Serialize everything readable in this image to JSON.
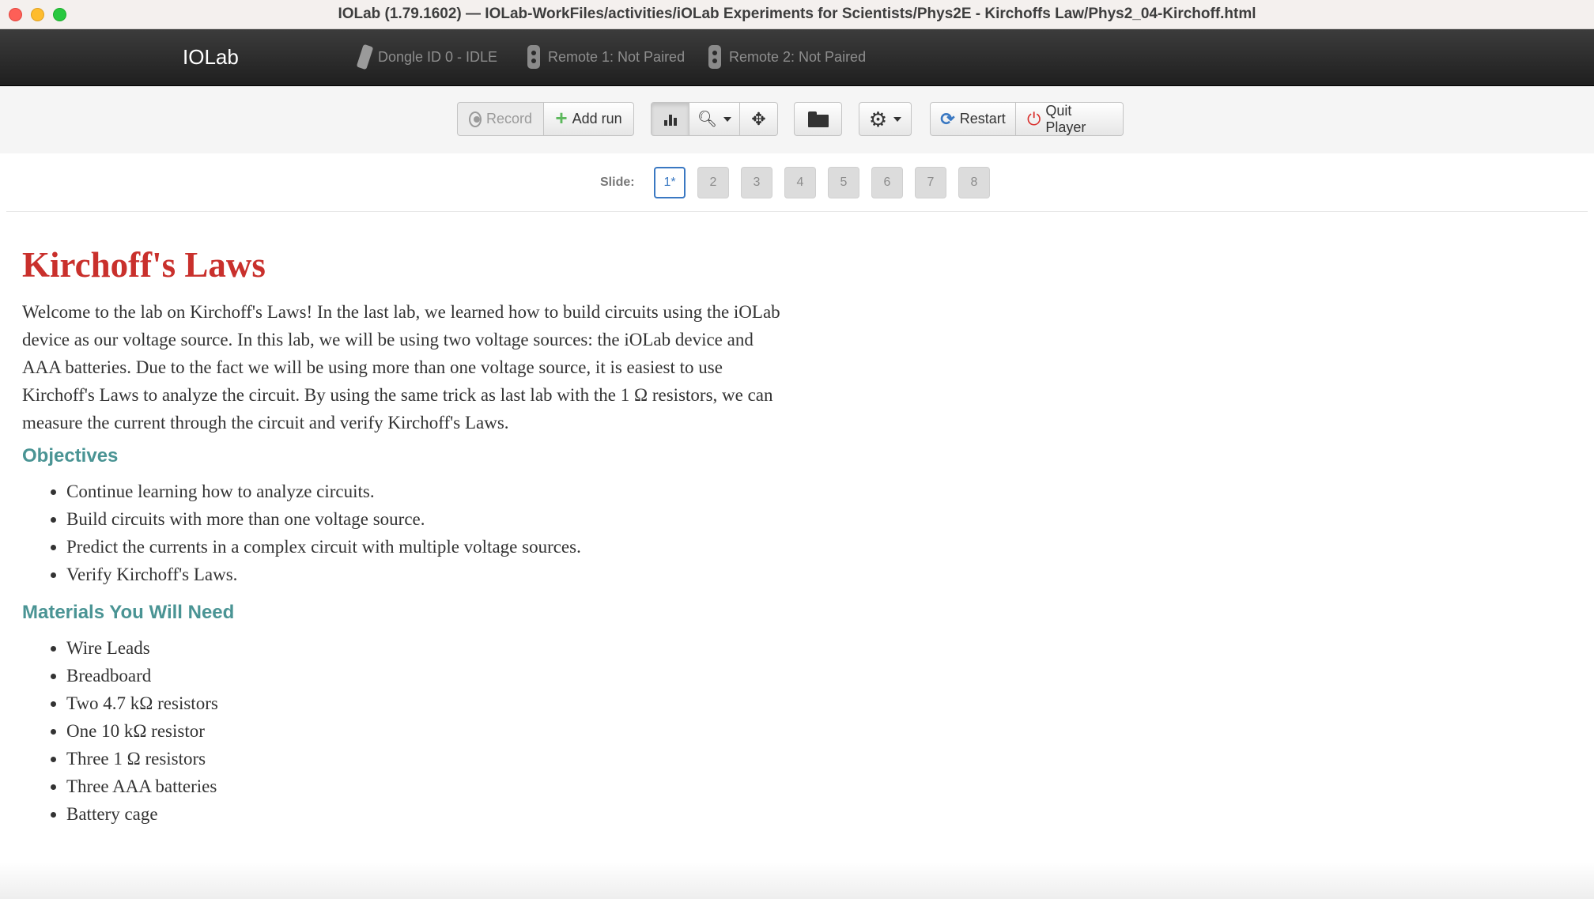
{
  "window": {
    "title": "IOLab (1.79.1602) — IOLab-WorkFiles/activities/iOLab Experiments for Scientists/Phys2E - Kirchoffs Law/Phys2_04-Kirchoff.html"
  },
  "navbar": {
    "brand": "IOLab",
    "dongle_status": "Dongle ID 0 - IDLE",
    "remote1_status": "Remote 1: Not Paired",
    "remote2_status": "Remote 2: Not Paired",
    "icons": [
      "dongle-icon",
      "remote-icon",
      "remote-icon"
    ]
  },
  "toolbar": {
    "record_label": "Record",
    "add_run_label": "Add run",
    "restart_label": "Restart",
    "quit_label": "Quit Player",
    "icons": [
      "record-icon",
      "plus-icon",
      "bar-chart-icon",
      "zoom-icon",
      "move-icon",
      "folder-icon",
      "gear-icon",
      "refresh-icon",
      "power-icon"
    ]
  },
  "slides": {
    "label": "Slide:",
    "items": [
      "1*",
      "2",
      "3",
      "4",
      "5",
      "6",
      "7",
      "8"
    ],
    "active_index": 0
  },
  "lab": {
    "title": "Kirchoff's Laws",
    "intro": "Welcome to the lab on Kirchoff's Laws! In the last lab, we learned how to build circuits using the iOLab device as our voltage source. In this lab, we will be using two voltage sources: the iOLab device and AAA batteries. Due to the fact we will be using more than one voltage source, it is easiest to use Kirchoff's Laws to analyze the circuit. By using the same trick as last lab with the 1 Ω resistors, we can measure the current through the circuit and verify Kirchoff's Laws.",
    "objectives_title": "Objectives",
    "objectives": [
      "Continue learning how to analyze circuits.",
      "Build circuits with more than one voltage source.",
      "Predict the currents in a complex circuit with multiple voltage sources.",
      "Verify Kirchoff's Laws."
    ],
    "materials_title": "Materials You Will Need",
    "materials": [
      "Wire Leads",
      "Breadboard",
      "Two 4.7 kΩ resistors",
      "One 10 kΩ resistor",
      "Three 1 Ω resistors",
      "Three AAA batteries",
      "Battery cage"
    ]
  },
  "colors": {
    "title_red": "#c9302c",
    "section_teal": "#4a9494",
    "active_slide_blue": "#3a78c2",
    "add_green": "#5cb85c",
    "quit_red": "#d9302d"
  }
}
